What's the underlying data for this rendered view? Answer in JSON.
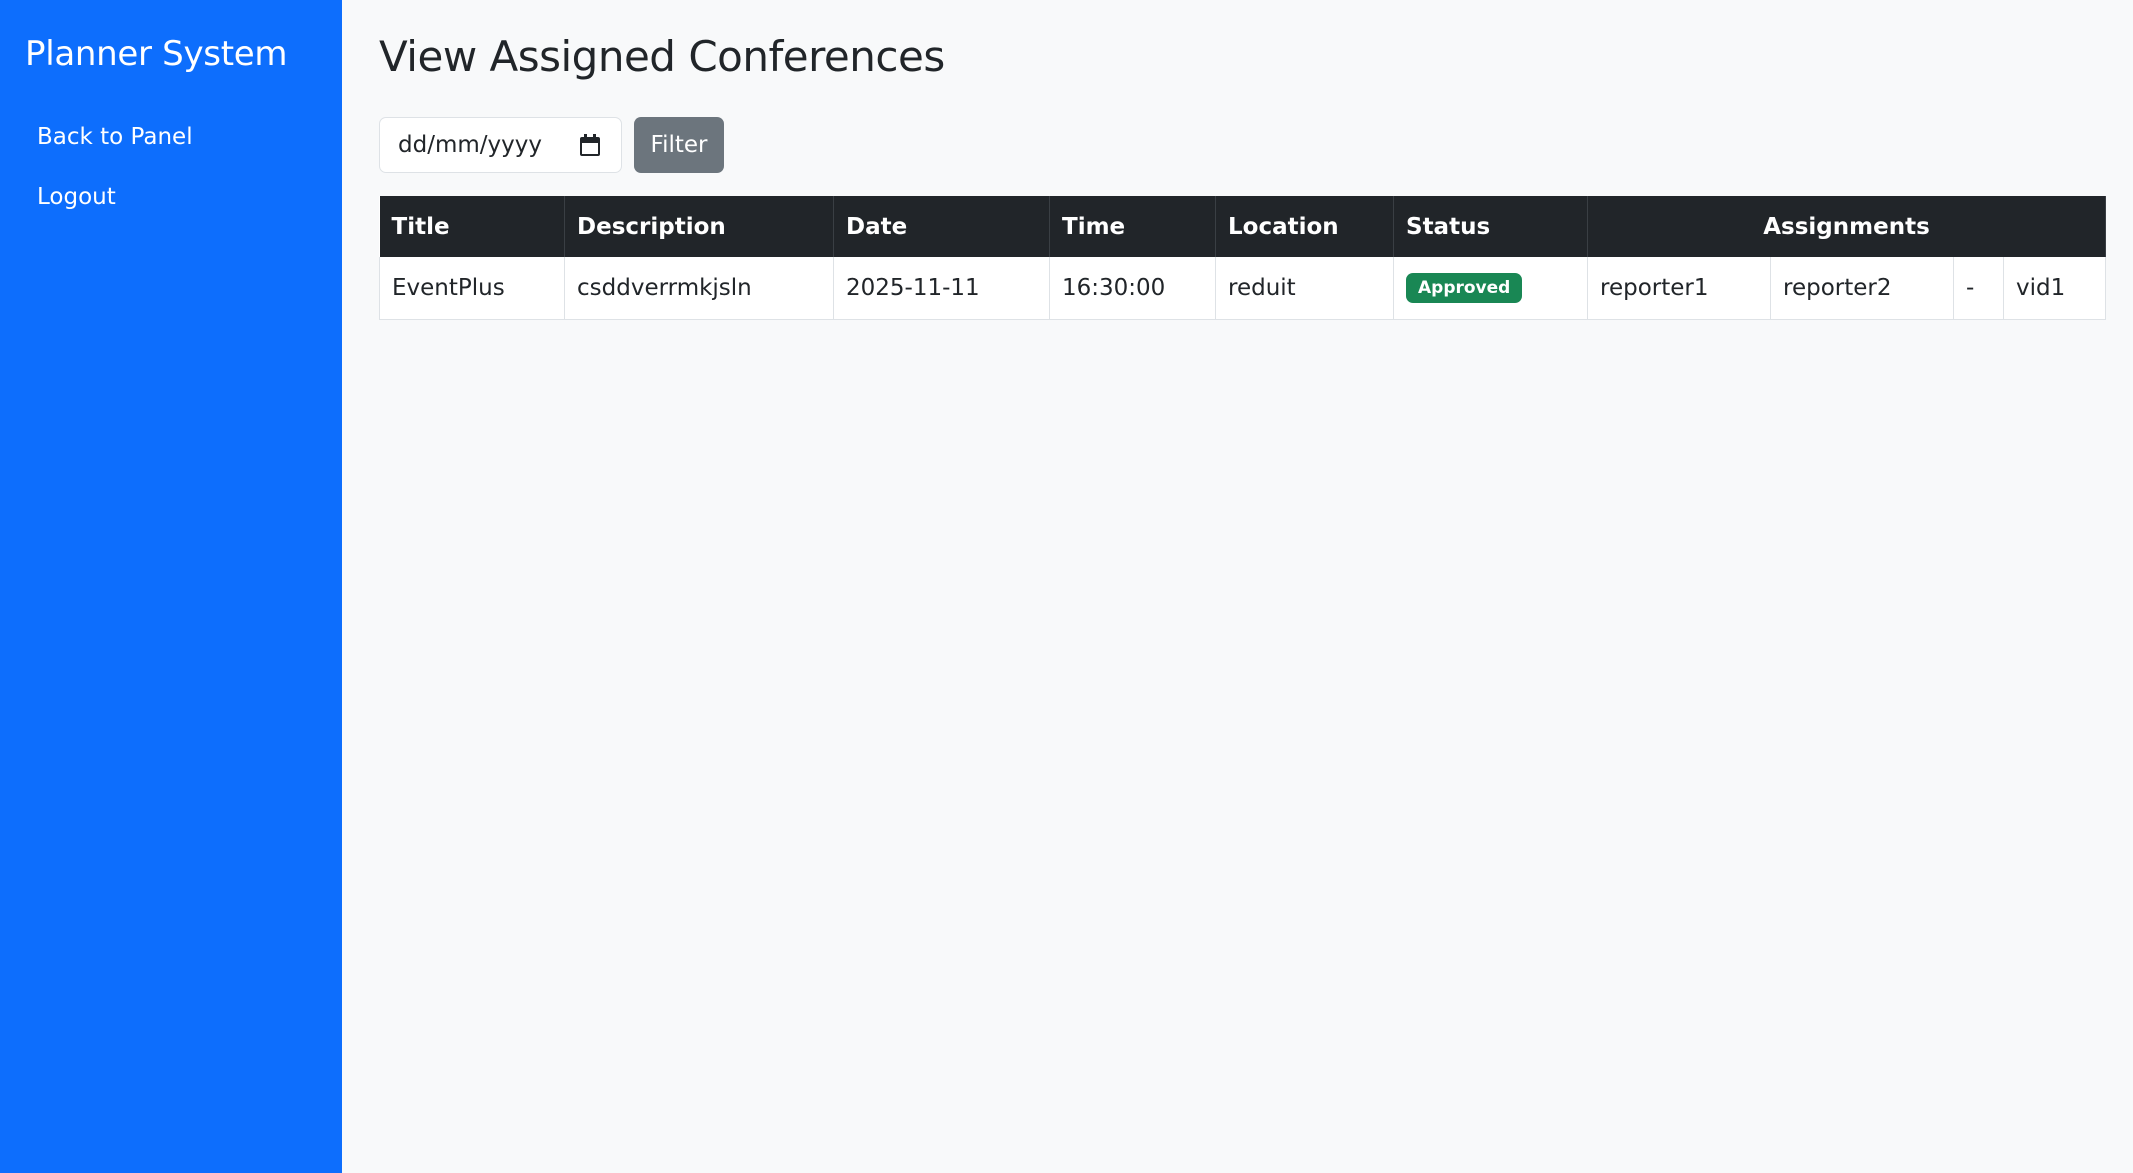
{
  "sidebar": {
    "brand": "Planner System",
    "items": [
      {
        "label": "Back to Panel"
      },
      {
        "label": "Logout"
      }
    ]
  },
  "main": {
    "title": "View Assigned Conferences",
    "filter": {
      "date_placeholder": "dd/mm/yyyy",
      "button_label": "Filter"
    },
    "table": {
      "headers": {
        "title": "Title",
        "description": "Description",
        "date": "Date",
        "time": "Time",
        "location": "Location",
        "status": "Status",
        "assignments": "Assignments"
      },
      "rows": [
        {
          "title": "EventPlus",
          "description": "csddverrmkjsln",
          "date": "2025-11-11",
          "time": "16:30:00",
          "location": "reduit",
          "status": "Approved",
          "assignments": [
            "reporter1",
            "reporter2",
            "-",
            "vid1"
          ]
        }
      ]
    }
  },
  "colors": {
    "sidebar": "#0d6efd",
    "table_header": "#212529",
    "status_approved": "#198754",
    "filter_button": "#6c757d"
  }
}
